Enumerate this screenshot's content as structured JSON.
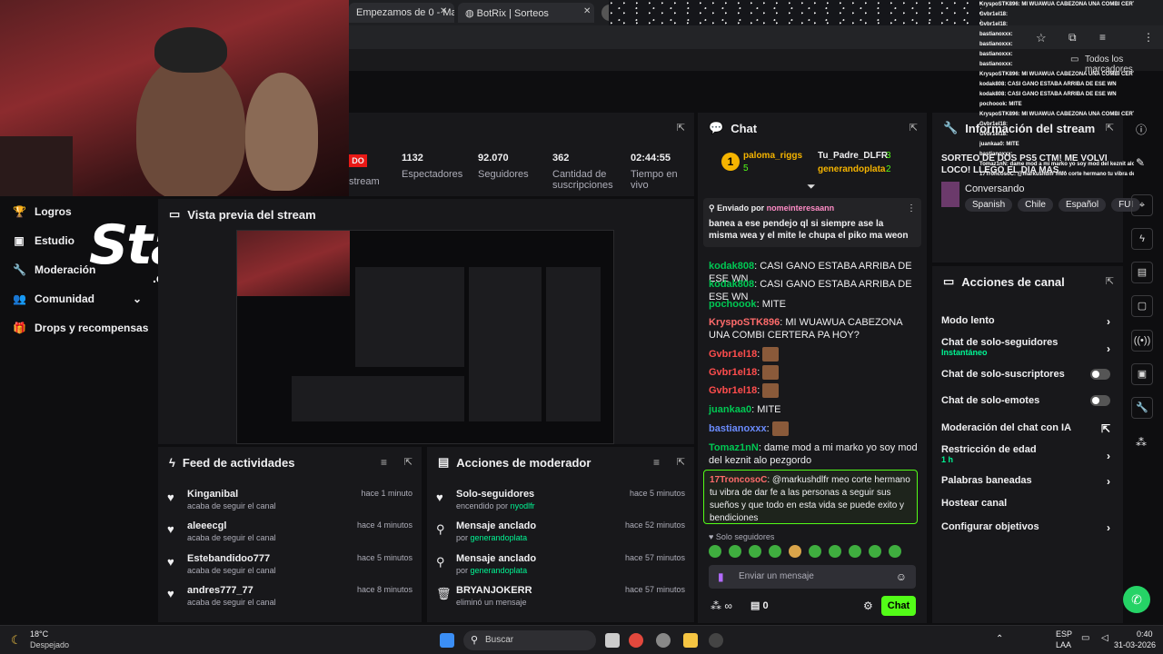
{
  "browser": {
    "tabs": [
      "Empezamos de 0 - Markush",
      "BotRix | Sorteos"
    ],
    "bookmarks_label": "Todos los marcadores"
  },
  "nav": {
    "items": [
      {
        "label": "Logros",
        "icon": "trophy-icon"
      },
      {
        "label": "Estudio",
        "icon": "studio-icon"
      },
      {
        "label": "Moderación",
        "icon": "wrench-icon"
      },
      {
        "label": "Comunidad",
        "icon": "community-icon"
      },
      {
        "label": "Drops y recompensas",
        "icon": "gift-icon"
      }
    ]
  },
  "stake_logo": {
    "main": "Stake",
    "sub": ".com"
  },
  "stats": {
    "live_badge": "DO",
    "stream_label": "stream",
    "viewers": {
      "value": "1132",
      "label": "Espectadores"
    },
    "followers": {
      "value": "92.070",
      "label": "Seguidores"
    },
    "subs": {
      "value": "362",
      "label": "Cantidad de suscripciones"
    },
    "time": {
      "value": "02:44:55",
      "label": "Tiempo en vivo"
    }
  },
  "preview": {
    "title": "Vista previa del stream"
  },
  "feed": {
    "title": "Feed de actividades",
    "rows": [
      {
        "name": "Kinganibal",
        "sub": "acaba de seguir el canal",
        "time": "hace 1 minuto"
      },
      {
        "name": "aleeecgl",
        "sub": "acaba de seguir el canal",
        "time": "hace 4 minutos"
      },
      {
        "name": "Estebandidoo777",
        "sub": "acaba de seguir el canal",
        "time": "hace 5 minutos"
      },
      {
        "name": "andres777_77",
        "sub": "acaba de seguir el canal",
        "time": "hace 8 minutos"
      }
    ]
  },
  "mod_actions": {
    "title": "Acciones de moderador",
    "rows": [
      {
        "name": "Solo-seguidores",
        "pre": "encendido por",
        "by": "nyodlfr",
        "time": "hace 5 minutos",
        "icon": "heart-icon"
      },
      {
        "name": "Mensaje anclado",
        "pre": "por",
        "by": "generandoplata",
        "time": "hace 52 minutos",
        "icon": "pin-icon"
      },
      {
        "name": "Mensaje anclado",
        "pre": "por",
        "by": "generandoplata",
        "time": "hace 57 minutos",
        "icon": "pin-icon"
      },
      {
        "name": "BRYANJOKERR",
        "pre": "eliminó un mensaje",
        "by": "",
        "time": "hace 57 minutos",
        "icon": "trash-icon"
      }
    ]
  },
  "chat": {
    "title": "Chat",
    "leaderboard": [
      {
        "name": "paloma_riggs",
        "count": "5"
      },
      {
        "name": "Tu_Padre_DLFR",
        "count": "3"
      },
      {
        "name": "generandoplata",
        "count": "2"
      }
    ],
    "leader_rank": "1",
    "pinned": {
      "label": "Enviado por",
      "by": "nomeinteresaann",
      "text": "banea a ese pendejo ql si siempre ase la misma wea y el mite le chupa el piko ma weon"
    },
    "messages": [
      {
        "user": "kodak808",
        "color": "#00c853",
        "text": "CASI GANO ESTABA ARRIBA DE ESE WN"
      },
      {
        "user": "kodak808",
        "color": "#00c853",
        "text": "CASI GANO ESTABA ARRIBA DE ESE WN"
      },
      {
        "user": "pochoook",
        "color": "#00c853",
        "text": "MITE"
      },
      {
        "user": "KryspoSTK896",
        "color": "#ff6b6b",
        "text": "MI WUAWUA CABEZONA UNA COMBI CERTERA PA HOY?"
      },
      {
        "user": "Gvbr1el18",
        "color": "#ff4d4d",
        "text": ""
      },
      {
        "user": "Gvbr1el18",
        "color": "#ff4d4d",
        "text": ""
      },
      {
        "user": "Gvbr1el18",
        "color": "#ff4d4d",
        "text": ""
      },
      {
        "user": "juankaa0",
        "color": "#00c853",
        "text": "MITE"
      },
      {
        "user": "bastianoxxx",
        "color": "#6b8cff",
        "text": ""
      },
      {
        "user": "Tomaz1nN",
        "color": "#00c853",
        "text": "dame mod a mi marko yo soy mod del keznit alo pezgordo"
      }
    ],
    "highlight": {
      "user": "17TroncosoC",
      "text": "@markushdlfr meo corte hermano tu vibra de dar fe a las personas a seguir sus sueños y que todo en esta vida se puede exito y bendiciones"
    },
    "followers_only": "Solo seguidores",
    "input_placeholder": "Enviar un mensaje",
    "points": "0",
    "send_label": "Chat"
  },
  "stream_info": {
    "title": "Información del stream",
    "stream_title": "SORTEO DE DOS PS5 CTM! ME VOLVI LOCO! LLEGO EL DIA MAS...",
    "category": "Conversando",
    "tags": [
      "Spanish",
      "Chile",
      "Español",
      "FUI"
    ]
  },
  "channel_actions": {
    "title": "Acciones de canal",
    "items": [
      {
        "label": "Modo lento",
        "sub": "",
        "control": "chevron"
      },
      {
        "label": "Chat de solo-seguidores",
        "sub": "Instantáneo",
        "control": "chevron"
      },
      {
        "label": "Chat de solo-suscriptores",
        "sub": "",
        "control": "toggle"
      },
      {
        "label": "Chat de solo-emotes",
        "sub": "",
        "control": "toggle"
      },
      {
        "label": "Moderación del chat con IA",
        "sub": "",
        "control": "external"
      },
      {
        "label": "Restricción de edad",
        "sub": "1 h",
        "control": "chevron"
      },
      {
        "label": "Palabras baneadas",
        "sub": "",
        "control": "chevron"
      },
      {
        "label": "Hostear canal",
        "sub": "",
        "control": "none"
      },
      {
        "label": "Configurar objetivos",
        "sub": "",
        "control": "chevron"
      }
    ]
  },
  "overlay_lines": [
    "KryspoSTK896: MI WUAWUA CABEZONA UNA COMBI CERTERA PA HOY?",
    "Gvbr1el18:",
    "Gvbr1el18:",
    "bastianoxxx:",
    "bastianoxxx:",
    "bastianoxxx:",
    "bastianoxxx:",
    "KryspoSTK896: MI WUAWUA CABEZONA UNA COMBI CERTERA PA HOY?",
    "kodak808: CASI GANO ESTABA ARRIBA DE ESE WN",
    "kodak808: CASI GANO ESTABA ARRIBA DE ESE WN",
    "pochoook: MITE",
    "KryspoSTK896: MI WUAWUA CABEZONA UNA COMBI CERTERA PA HOY?",
    "Gvbr1el18:",
    "Gvbr1el18:",
    "juankaa0: MITE",
    "bastianoxxx:",
    "Tomaz1nN: dame mod a mi marko yo soy mod del keznit alo pezgordo",
    "17TroncosoC: @markushdlfr meo corte hermano tu vibra de dar fe a las personas a seguir sus sueños y que todo en esta vida se puede exito y bendiciones"
  ],
  "taskbar": {
    "weather_temp": "18°C",
    "weather_desc": "Despejado",
    "search_placeholder": "Buscar",
    "lang": "ESP",
    "lang2": "LAA",
    "time": "0:40",
    "date": "31-03-2026"
  },
  "colors": {
    "accent": "#53fc18",
    "bg": "#0e0e10",
    "panel": "#18181b"
  }
}
